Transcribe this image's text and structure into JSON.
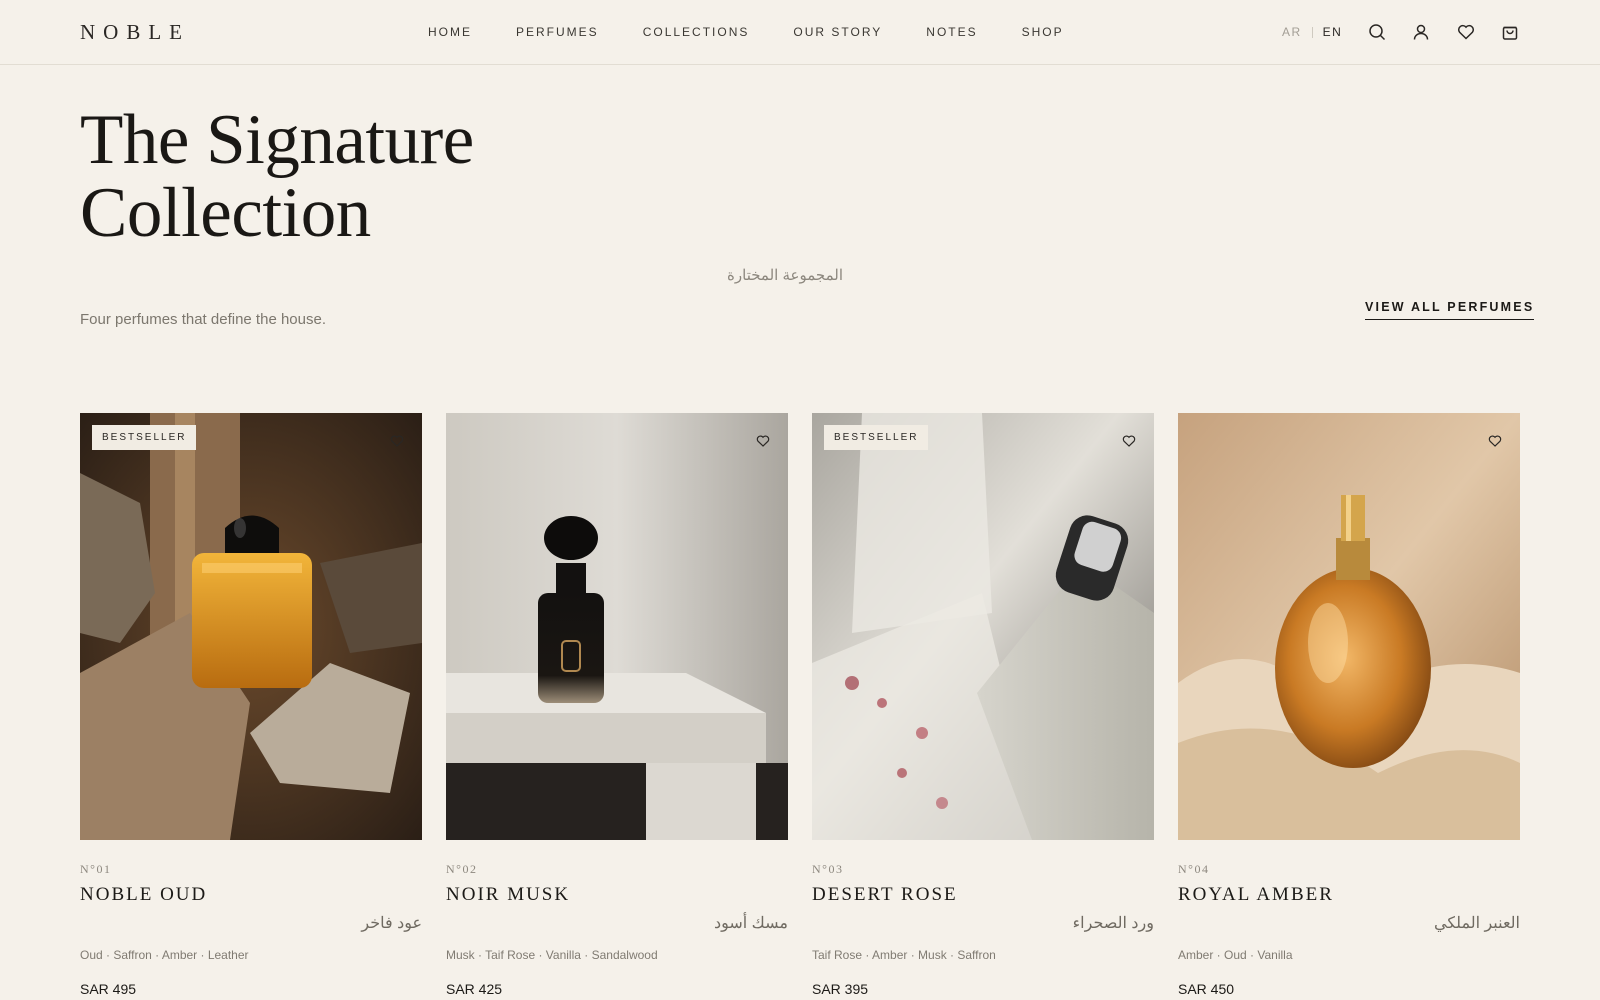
{
  "header": {
    "logo": "NOBLE",
    "nav": [
      "HOME",
      "PERFUMES",
      "COLLECTIONS",
      "OUR STORY",
      "NOTES",
      "SHOP"
    ],
    "lang": {
      "ar": "AR",
      "en": "EN"
    },
    "icons": [
      "search-icon",
      "account-icon",
      "wishlist-icon",
      "cart-icon"
    ]
  },
  "hero": {
    "title_line1": "The Signature",
    "title_line2": "Collection",
    "arabic_subtitle": "المجموعة المختارة",
    "tagline": "Four perfumes that define the house.",
    "view_all": "VIEW ALL PERFUMES"
  },
  "products": [
    {
      "number": "N°01",
      "name": "NOBLE OUD",
      "arabic": "عود فاخر",
      "notes": "Oud · Saffron · Amber · Leather",
      "price": "SAR 495",
      "badge": "BESTSELLER",
      "image": "amber glass bottle with black cap among rocks and wood"
    },
    {
      "number": "N°02",
      "name": "NOIR MUSK",
      "arabic": "مسك أسود",
      "notes": "Musk · Taif Rose · Vanilla · Sandalwood",
      "price": "SAR 425",
      "badge": "",
      "image": "dark bottle on white shelf"
    },
    {
      "number": "N°03",
      "name": "DESERT ROSE",
      "arabic": "ورد الصحراء",
      "notes": "Taif Rose · Amber · Musk · Saffron",
      "price": "SAR 395",
      "badge": "BESTSELLER",
      "image": "frosted bottle with silver cap, blurred background"
    },
    {
      "number": "N°04",
      "name": "ROYAL AMBER",
      "arabic": "العنبر الملكي",
      "notes": "Amber · Oud · Vanilla",
      "price": "SAR 450",
      "badge": "",
      "image": "golden oval bottle on satin"
    }
  ],
  "colors": {
    "background": "#f5f1ea",
    "text": "#1c1a17",
    "muted": "#807b72"
  }
}
